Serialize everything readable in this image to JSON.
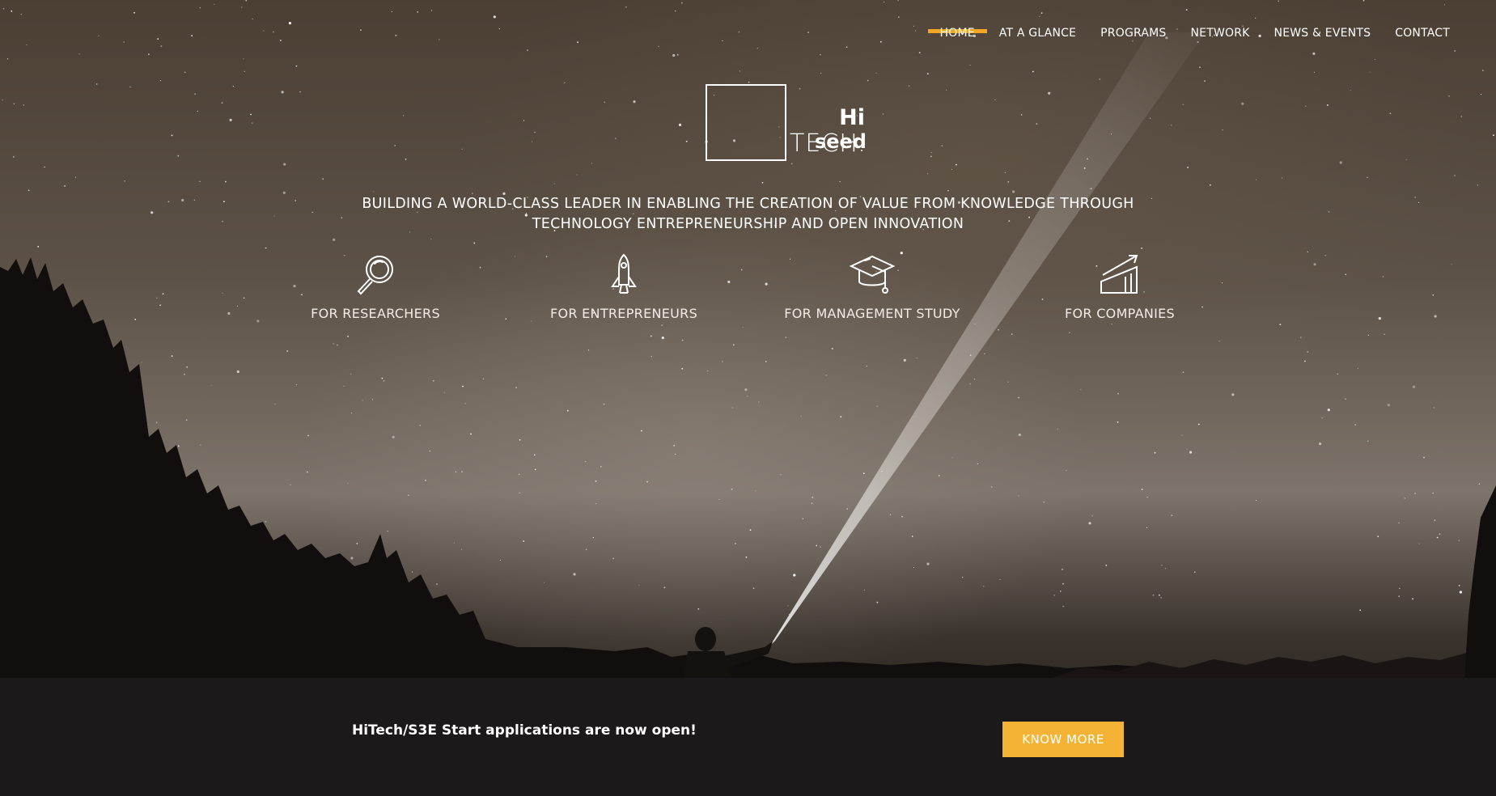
{
  "nav": {
    "items": [
      {
        "label": "HOME",
        "active": true
      },
      {
        "label": "AT A GLANCE"
      },
      {
        "label": "PROGRAMS"
      },
      {
        "label": "NETWORK"
      },
      {
        "label": "NEWS & EVENTS"
      },
      {
        "label": "CONTACT"
      }
    ]
  },
  "logo": {
    "hi": "Hi",
    "seed": "seed",
    "tech": "TECH."
  },
  "tagline": {
    "line1": "BUILDING A WORLD-CLASS LEADER IN ENABLING THE CREATION OF VALUE FROM KNOWLEDGE THROUGH",
    "line2": "TECHNOLOGY ENTREPRENEURSHIP AND OPEN INNOVATION"
  },
  "audiences": [
    {
      "label": "FOR RESEARCHERS",
      "icon": "magnifier-icon"
    },
    {
      "label": "FOR ENTREPRENEURS",
      "icon": "rocket-icon"
    },
    {
      "label": "FOR MANAGEMENT STUDY",
      "icon": "graduation-cap-icon"
    },
    {
      "label": "FOR COMPANIES",
      "icon": "growth-chart-icon"
    }
  ],
  "banner": {
    "text": "HiTech/S3E Start applications are now open!",
    "button": "KNOW MORE"
  },
  "colors": {
    "accent": "#f5a623",
    "button": "#f5b335",
    "bar": "#1c1a1b"
  }
}
